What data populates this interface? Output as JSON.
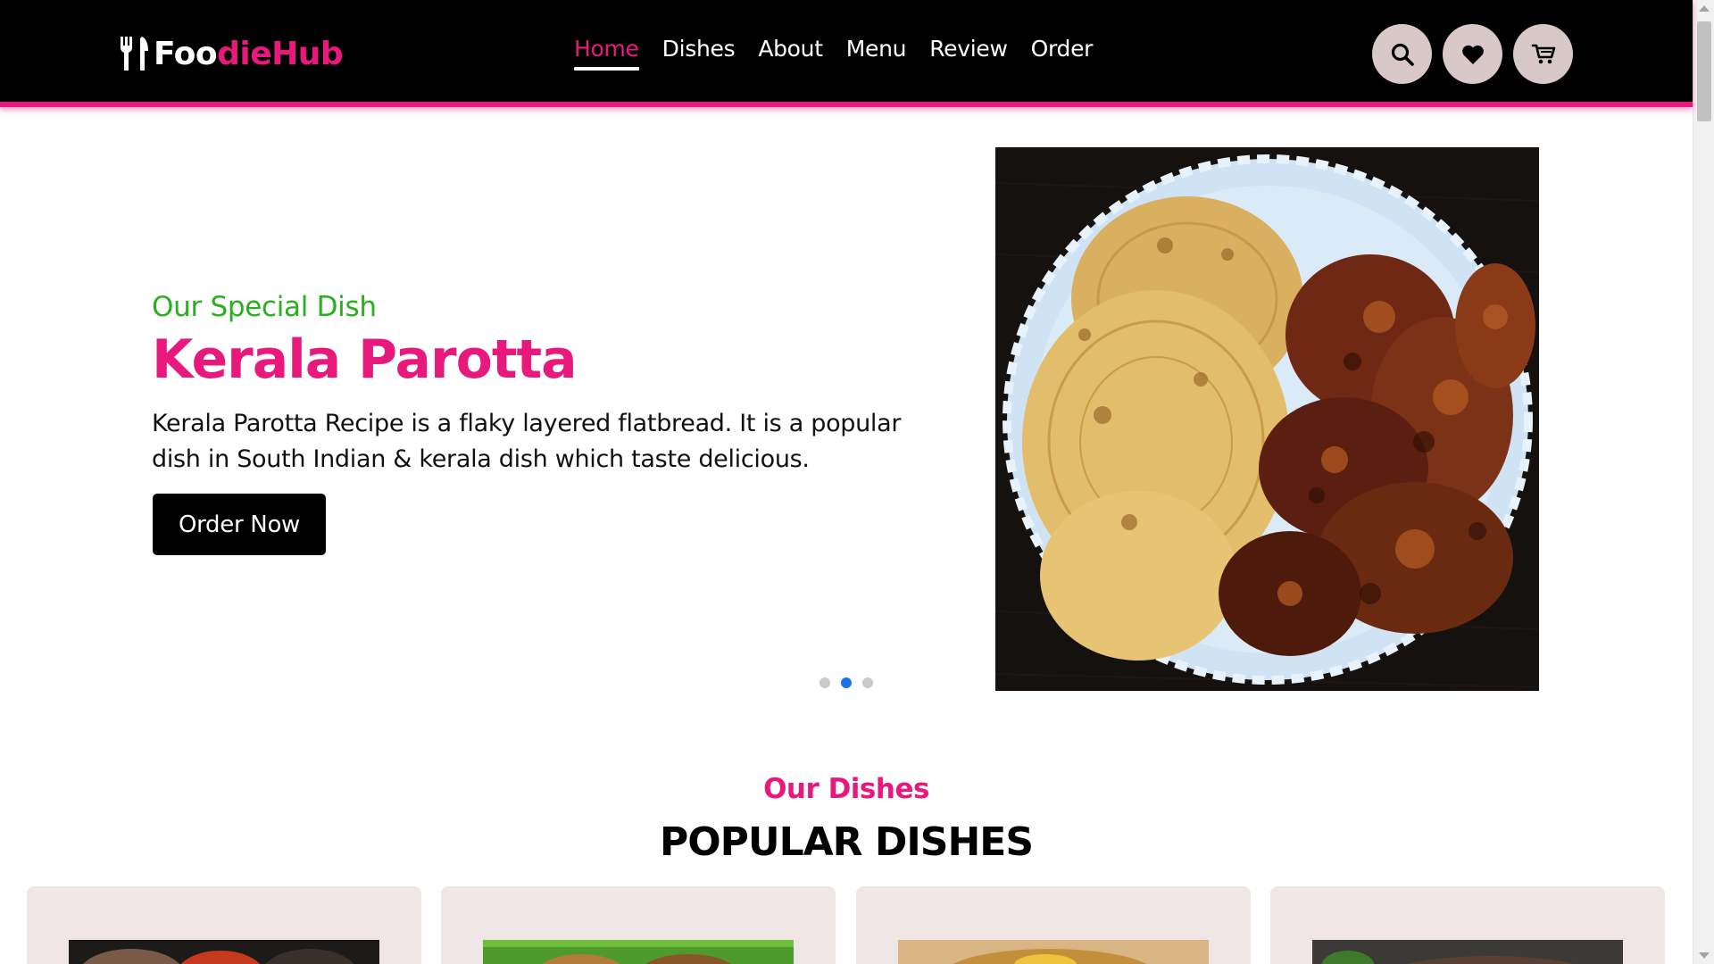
{
  "brand": {
    "name_white": "Foo",
    "name_pink": "dieHub",
    "accent": "#e8197d"
  },
  "nav": {
    "items": [
      {
        "label": "Home",
        "active": true
      },
      {
        "label": "Dishes",
        "active": false
      },
      {
        "label": "About",
        "active": false
      },
      {
        "label": "Menu",
        "active": false
      },
      {
        "label": "Review",
        "active": false
      },
      {
        "label": "Order",
        "active": false
      }
    ]
  },
  "header_icons": [
    "search-icon",
    "heart-icon",
    "cart-icon"
  ],
  "hero": {
    "subtitle": "Our Special Dish",
    "title": "Kerala Parotta",
    "description": "Kerala Parotta Recipe is a flaky layered flatbread. It is a popular dish in South Indian & kerala dish which taste delicious.",
    "button_label": "Order Now",
    "slides_total": 3,
    "active_slide": 2,
    "subtitle_color": "#28b01d"
  },
  "section": {
    "subtitle": "Our Dishes",
    "title": "POPULAR DISHES"
  },
  "cards_visible": 4
}
